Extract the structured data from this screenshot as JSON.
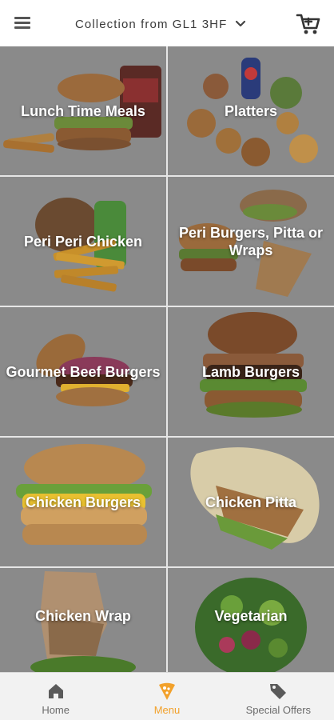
{
  "header": {
    "location_label": "Collection from GL1 3HF",
    "menu_icon": "hamburger-menu-icon",
    "chevron_icon": "chevron-down-icon",
    "cart_icon": "shopping-cart-icon"
  },
  "categories": [
    {
      "label": "Lunch Time Meals"
    },
    {
      "label": "Platters"
    },
    {
      "label": "Peri Peri Chicken"
    },
    {
      "label": "Peri Burgers, Pitta or Wraps"
    },
    {
      "label": "Gourmet Beef Burgers"
    },
    {
      "label": "Lamb Burgers"
    },
    {
      "label": "Chicken Burgers"
    },
    {
      "label": "Chicken Pitta"
    },
    {
      "label": "Chicken Wrap"
    },
    {
      "label": "Vegetarian"
    }
  ],
  "nav": {
    "home": "Home",
    "menu": "Menu",
    "offers": "Special Offers",
    "active": "Menu",
    "accent_color": "#f2a12b",
    "inactive_color": "#6a6a6a"
  }
}
